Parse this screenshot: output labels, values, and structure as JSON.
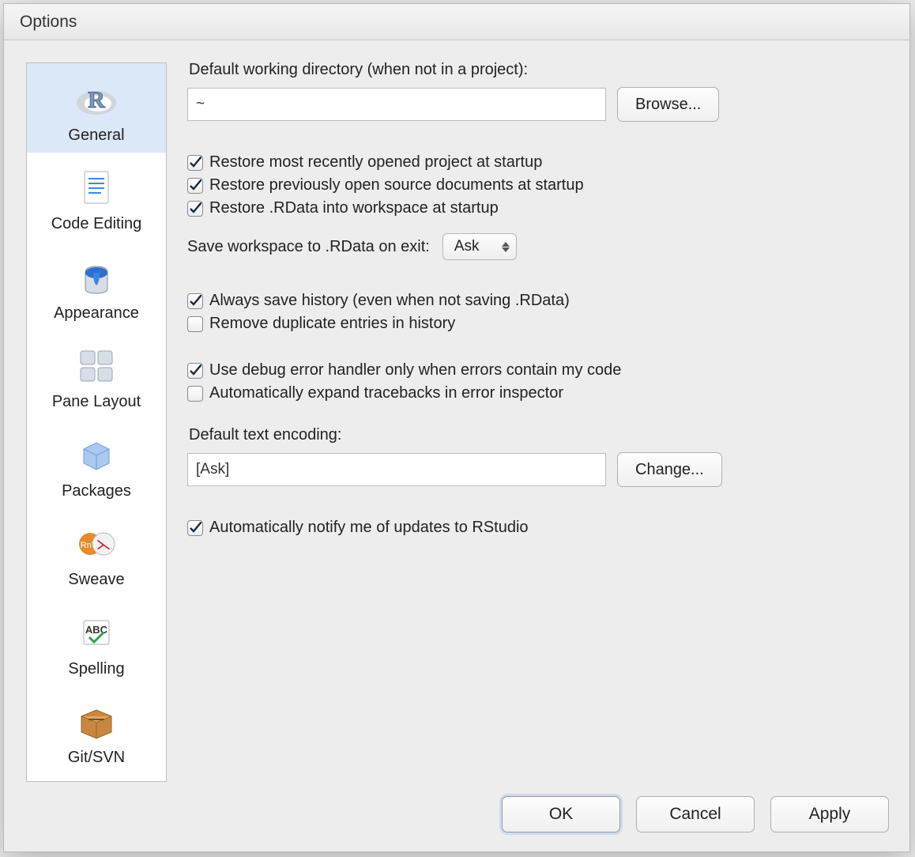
{
  "window": {
    "title": "Options"
  },
  "sidebar": {
    "items": [
      {
        "label": "General"
      },
      {
        "label": "Code Editing"
      },
      {
        "label": "Appearance"
      },
      {
        "label": "Pane Layout"
      },
      {
        "label": "Packages"
      },
      {
        "label": "Sweave"
      },
      {
        "label": "Spelling"
      },
      {
        "label": "Git/SVN"
      }
    ],
    "selected_index": 0
  },
  "general": {
    "working_dir_label": "Default working directory (when not in a project):",
    "working_dir_value": "~",
    "browse_button": "Browse...",
    "checks": {
      "restore_project": "Restore most recently opened project at startup",
      "restore_docs": "Restore previously open source documents at startup",
      "restore_rdata": "Restore .RData into workspace at startup",
      "always_save_history": "Always save history (even when not saving .RData)",
      "remove_dup_history": "Remove duplicate entries in history",
      "debug_handler": "Use debug error handler only when errors contain my code",
      "expand_tracebacks": "Automatically expand tracebacks in error inspector",
      "notify_updates": "Automatically notify me of updates to RStudio"
    },
    "checked": {
      "restore_project": true,
      "restore_docs": true,
      "restore_rdata": true,
      "always_save_history": true,
      "remove_dup_history": false,
      "debug_handler": true,
      "expand_tracebacks": false,
      "notify_updates": true
    },
    "save_workspace_label": "Save workspace to .RData on exit:",
    "save_workspace_value": "Ask",
    "encoding_label": "Default text encoding:",
    "encoding_value": "[Ask]",
    "change_button": "Change..."
  },
  "footer": {
    "ok": "OK",
    "cancel": "Cancel",
    "apply": "Apply"
  }
}
